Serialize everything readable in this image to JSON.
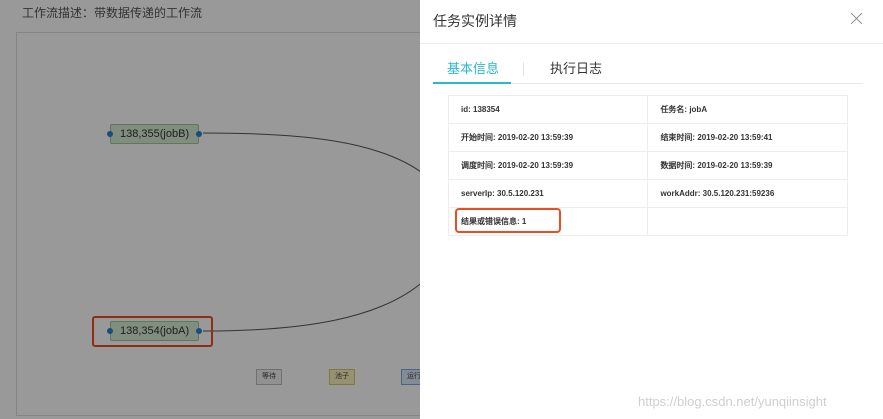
{
  "workflow": {
    "title": "工作流描述：带数据传递的工作流",
    "nodes": [
      {
        "label": "138,355(jobB)"
      },
      {
        "label": "138,354(jobA)"
      }
    ],
    "legend": [
      "等待",
      "池子",
      "运行"
    ]
  },
  "drawer": {
    "title": "任务实例详情",
    "tabs": [
      {
        "label": "基本信息",
        "active": true
      },
      {
        "label": "执行日志",
        "active": false
      }
    ],
    "details": [
      {
        "left": "id: 138354",
        "right": "任务名: jobA"
      },
      {
        "left": "开始时间: 2019-02-20 13:59:39",
        "right": "结束时间: 2019-02-20 13:59:41"
      },
      {
        "left": "调度时间: 2019-02-20 13:59:39",
        "right": "数据时间: 2019-02-20 13:59:39"
      },
      {
        "left": "serverIp: 30.5.120.231",
        "right": "workAddr: 30.5.120.231:59236"
      },
      {
        "left": "结果或错误信息: 1",
        "right": ""
      }
    ]
  },
  "watermark": "https://blog.csdn.net/yunqiinsight",
  "colors": {
    "accent": "#2bb7d2",
    "highlight": "#ee4d22",
    "node_fill": "#d7ecd4",
    "port": "#2d7fd6"
  }
}
